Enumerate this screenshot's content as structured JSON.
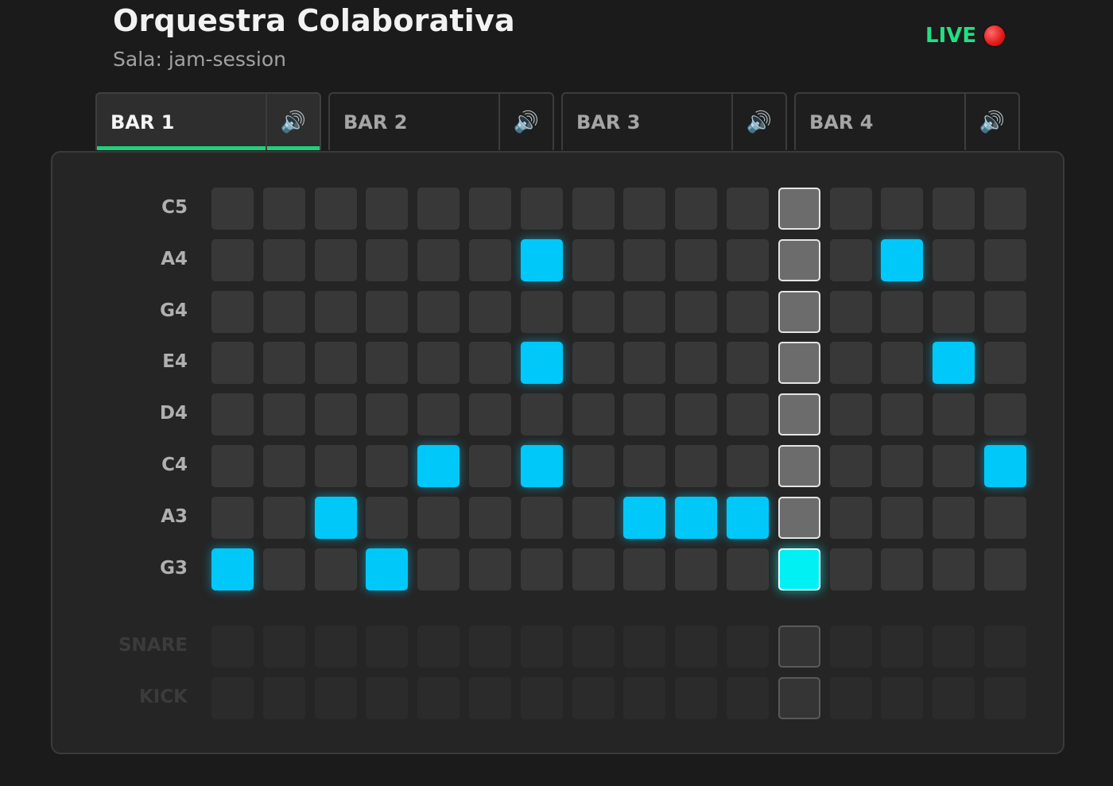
{
  "header": {
    "title": "Orquestra Colaborativa",
    "subtitle": "Sala: jam-session",
    "live_label": "LIVE",
    "live_icon": "red-circle-icon"
  },
  "tabs": [
    {
      "label": "BAR 1",
      "speaker_icon": "🔊",
      "active": true
    },
    {
      "label": "BAR 2",
      "speaker_icon": "🔊",
      "active": false
    },
    {
      "label": "BAR 3",
      "speaker_icon": "🔊",
      "active": false
    },
    {
      "label": "BAR 4",
      "speaker_icon": "🔊",
      "active": false
    }
  ],
  "sequencer": {
    "steps": 16,
    "playhead_step": 12,
    "note_rows": [
      {
        "label": "C5",
        "active_steps": []
      },
      {
        "label": "A4",
        "active_steps": [
          7,
          14
        ]
      },
      {
        "label": "G4",
        "active_steps": []
      },
      {
        "label": "E4",
        "active_steps": [
          7,
          15
        ]
      },
      {
        "label": "D4",
        "active_steps": []
      },
      {
        "label": "C4",
        "active_steps": [
          5,
          7,
          16
        ]
      },
      {
        "label": "A3",
        "active_steps": [
          3,
          9,
          10,
          11
        ]
      },
      {
        "label": "G3",
        "active_steps": [
          1,
          4,
          12
        ]
      }
    ],
    "drum_rows": [
      {
        "label": "SNARE",
        "active_steps": []
      },
      {
        "label": "KICK",
        "active_steps": []
      }
    ]
  },
  "colors": {
    "accent_green": "#1fd07a",
    "note_on": "#00c8f8",
    "playhead_note_on": "#00f0f4",
    "live_red": "#e21818"
  }
}
